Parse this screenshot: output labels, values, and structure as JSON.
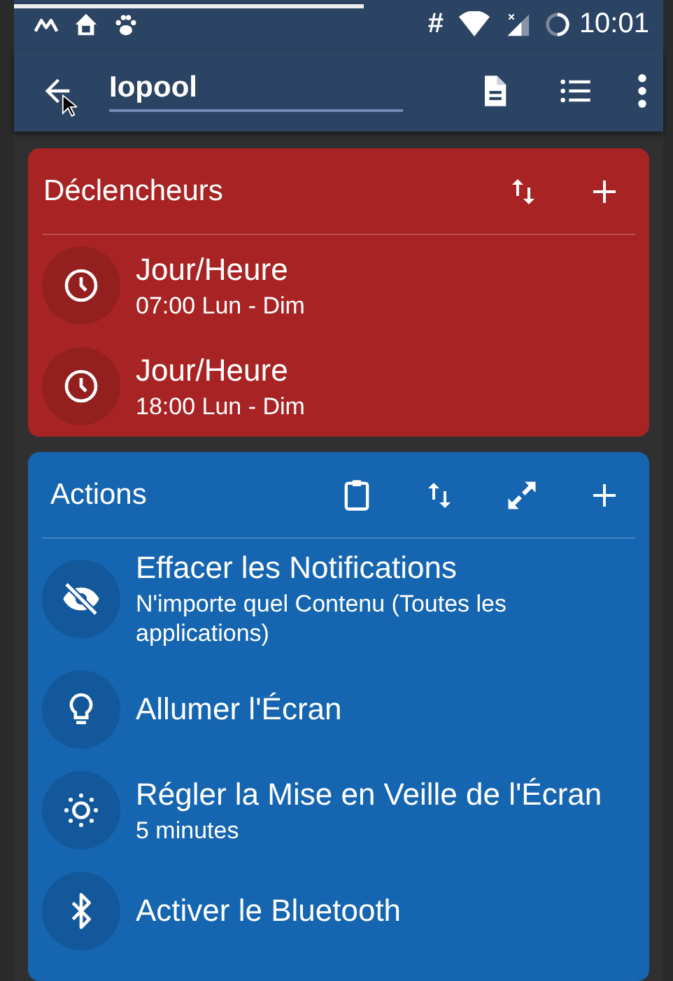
{
  "status_bar": {
    "hash": "#",
    "time": "10:01"
  },
  "toolbar": {
    "name_field": {
      "value": "Iopool"
    }
  },
  "sections": [
    {
      "kind": "triggers",
      "title": "Déclencheurs",
      "color": "#a82424",
      "items": [
        {
          "title": "Jour/Heure",
          "subtitle": "07:00 Lun - Dim"
        },
        {
          "title": "Jour/Heure",
          "subtitle": "18:00 Lun - Dim"
        }
      ]
    },
    {
      "kind": "actions",
      "title": "Actions",
      "color": "#1565b0",
      "items": [
        {
          "title": "Effacer les Notifications",
          "subtitle": "N'importe quel Contenu (Toutes les applications)"
        },
        {
          "title": "Allumer l'Écran"
        },
        {
          "title": "Régler la Mise en Veille de l'Écran",
          "subtitle": "5 minutes"
        },
        {
          "title": "Activer le Bluetooth"
        }
      ]
    }
  ]
}
